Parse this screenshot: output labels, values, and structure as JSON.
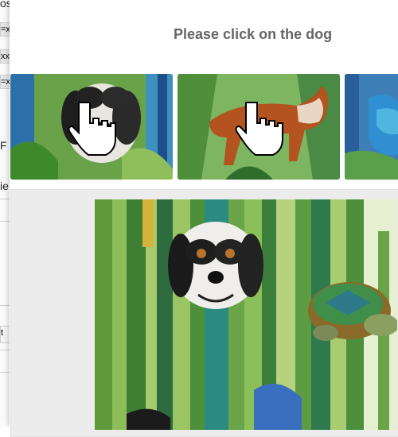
{
  "challenge": {
    "title": "Please click on the dog"
  },
  "background_fragments": [
    {
      "text": "os"
    },
    {
      "text": "=x"
    },
    {
      "text": "xx"
    },
    {
      "text": "=x"
    },
    {
      "text": "F"
    },
    {
      "text": "ie"
    },
    {
      "text": "t"
    }
  ],
  "thumbnails": [
    {
      "name": "thumb-dog-portrait",
      "icon": "hand-cursor-icon"
    },
    {
      "name": "thumb-dog-standing",
      "icon": "hand-cursor-icon"
    },
    {
      "name": "thumb-bird-partial"
    }
  ],
  "colors": {
    "title": "#666666",
    "panel_bg": "#ececec",
    "foliage_green": "#5a9a3a",
    "water_blue": "#2f6fb0"
  }
}
